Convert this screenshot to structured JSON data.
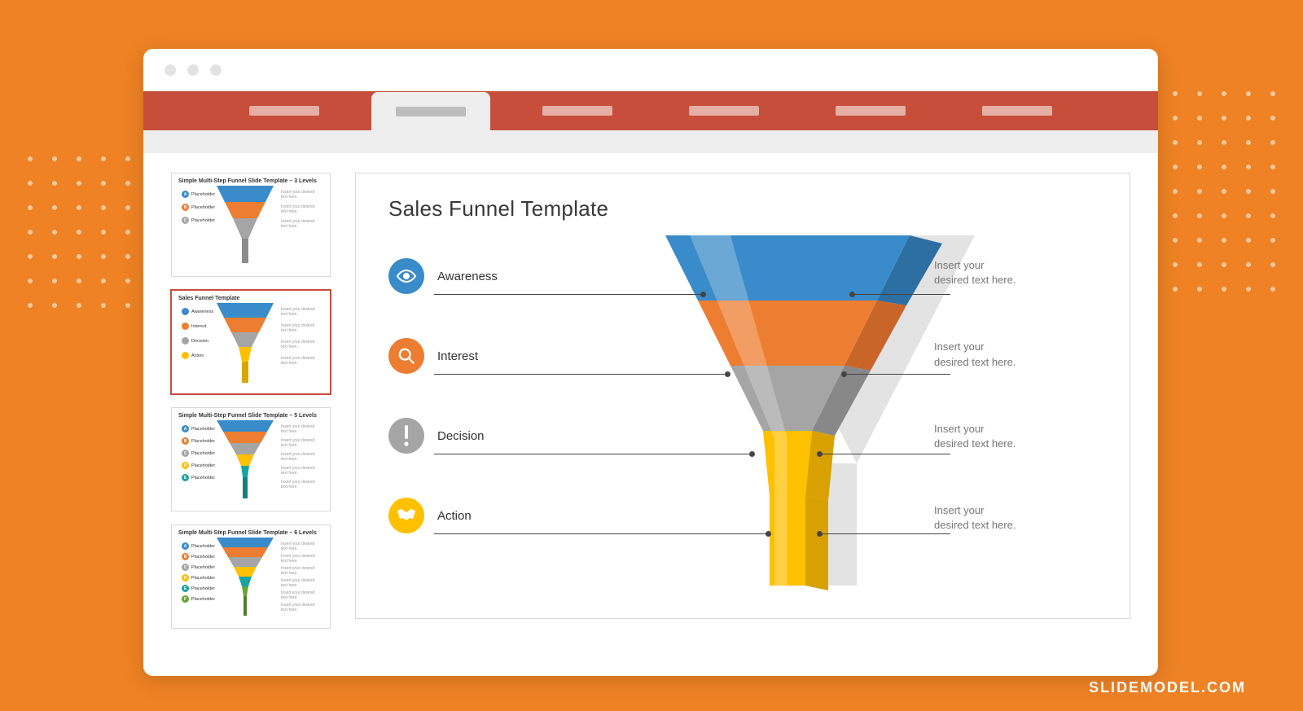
{
  "watermark": "SLIDEMODEL.COM",
  "ribbon": {
    "tabs": [
      "",
      "",
      "",
      "",
      "",
      ""
    ],
    "activeIndex": 1
  },
  "thumbs": [
    {
      "title": "Simple Multi-Step Funnel Slide Template – 3 Levels",
      "legend": [
        {
          "letter": "A",
          "color": "#3a8bc9",
          "label": "Placeholder"
        },
        {
          "letter": "B",
          "color": "#ed7d31",
          "label": "Placeholder"
        },
        {
          "letter": "C",
          "color": "#a5a5a5",
          "label": "Placeholder"
        }
      ],
      "desc": "Insert your desired text here."
    },
    {
      "title": "Sales Funnel Template",
      "legend": [
        {
          "letter": "",
          "color": "#3a8bc9",
          "label": "Awareness"
        },
        {
          "letter": "",
          "color": "#ed7d31",
          "label": "Interest"
        },
        {
          "letter": "",
          "color": "#a5a5a5",
          "label": "Decision"
        },
        {
          "letter": "",
          "color": "#ffc000",
          "label": "Action"
        }
      ],
      "desc": "Insert your desired text here."
    },
    {
      "title": "Simple Multi-Step Funnel Slide Template – 5 Levels",
      "legend": [
        {
          "letter": "A",
          "color": "#3a8bc9",
          "label": "Placeholder"
        },
        {
          "letter": "B",
          "color": "#ed7d31",
          "label": "Placeholder"
        },
        {
          "letter": "C",
          "color": "#a5a5a5",
          "label": "Placeholder"
        },
        {
          "letter": "D",
          "color": "#ffc000",
          "label": "Placeholder"
        },
        {
          "letter": "E",
          "color": "#1aa3a3",
          "label": "Placeholder"
        }
      ],
      "desc": "Insert your desired text here."
    },
    {
      "title": "Simple Multi-Step Funnel Slide Template – 6 Levels",
      "legend": [
        {
          "letter": "A",
          "color": "#3a8bc9",
          "label": "Placeholder"
        },
        {
          "letter": "B",
          "color": "#ed7d31",
          "label": "Placeholder"
        },
        {
          "letter": "C",
          "color": "#a5a5a5",
          "label": "Placeholder"
        },
        {
          "letter": "D",
          "color": "#ffc000",
          "label": "Placeholder"
        },
        {
          "letter": "E",
          "color": "#1aa3a3",
          "label": "Placeholder"
        },
        {
          "letter": "F",
          "color": "#68a436",
          "label": "Placeholder"
        }
      ],
      "desc": "Insert your desired text here."
    }
  ],
  "slide": {
    "title": "Sales Funnel Template",
    "stages": [
      {
        "name": "Awareness",
        "icon": "eye-icon",
        "color": "#3a8bc9",
        "desc": "Insert your\ndesired text here."
      },
      {
        "name": "Interest",
        "icon": "magnifier-icon",
        "color": "#ed7d31",
        "desc": "Insert your\ndesired text here."
      },
      {
        "name": "Decision",
        "icon": "exclamation-icon",
        "color": "#a5a5a5",
        "desc": "Insert your\ndesired text here."
      },
      {
        "name": "Action",
        "icon": "handshake-icon",
        "color": "#ffc000",
        "desc": "Insert your\ndesired text here."
      }
    ]
  },
  "chart_data": {
    "type": "funnel",
    "title": "Sales Funnel Template",
    "stages": [
      "Awareness",
      "Interest",
      "Decision",
      "Action"
    ],
    "colors": [
      "#3a8bc9",
      "#ed7d31",
      "#a5a5a5",
      "#ffc000"
    ],
    "descriptions": [
      "Insert your desired text here.",
      "Insert your desired text here.",
      "Insert your desired text here.",
      "Insert your desired text here."
    ]
  }
}
